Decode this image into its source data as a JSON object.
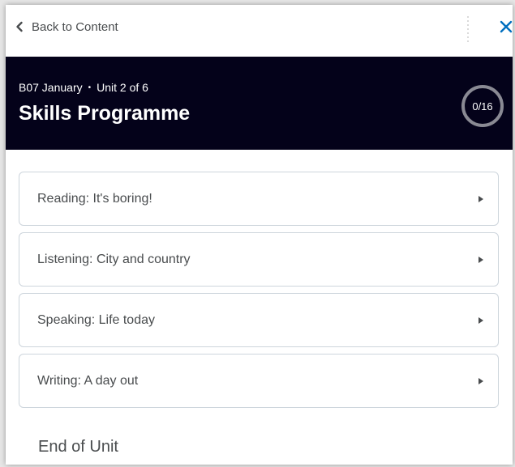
{
  "topbar": {
    "back_label": "Back to Content",
    "back_icon": "chevron-left-icon",
    "close_icon": "close-icon",
    "accent_color": "#006fbf"
  },
  "header": {
    "breadcrumb_course": "B07 January",
    "breadcrumb_separator": "•",
    "breadcrumb_unit": "Unit 2 of 6",
    "title": "Skills Programme",
    "progress_text": "0/16",
    "progress_fraction": 0,
    "background_color": "#04021a"
  },
  "items": [
    {
      "label": "Reading: It's boring!"
    },
    {
      "label": "Listening: City and country"
    },
    {
      "label": "Speaking: Life today"
    },
    {
      "label": "Writing: A day out"
    }
  ],
  "end_of_unit": "End of Unit"
}
